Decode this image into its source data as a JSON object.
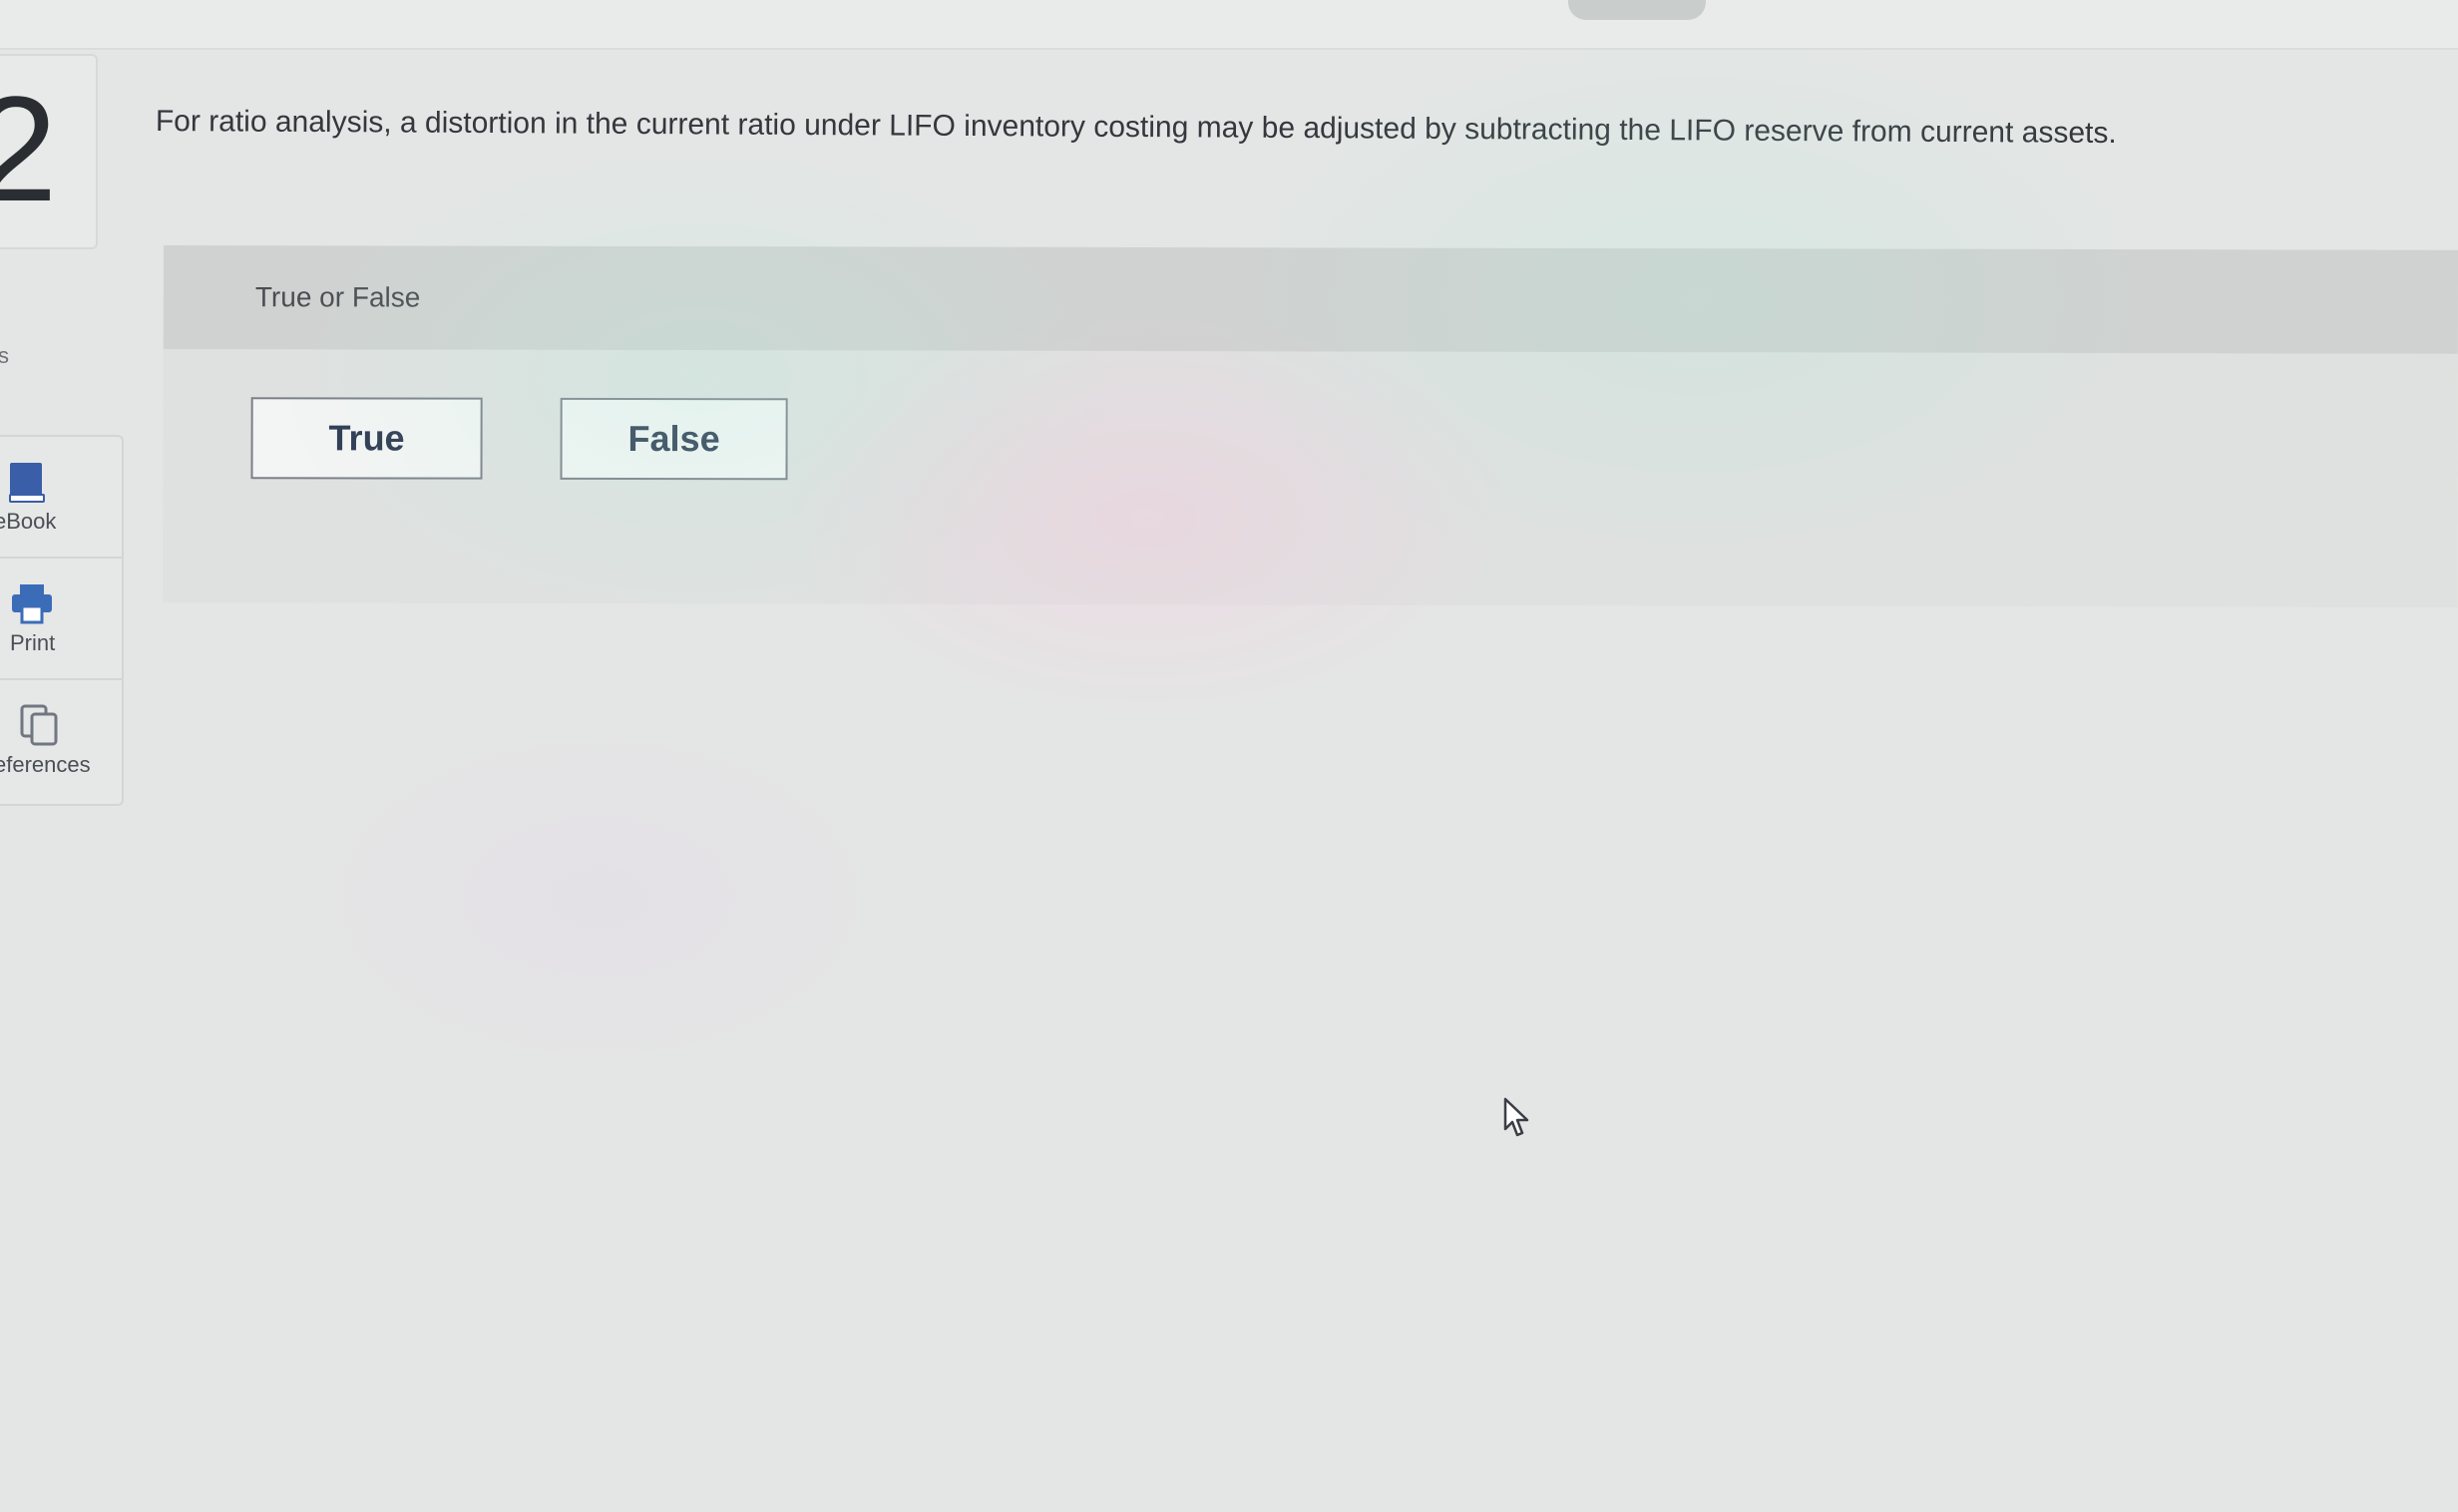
{
  "question": {
    "number": "2",
    "text": "For ratio analysis, a distortion in the current ratio under LIFO inventory costing may be adjusted by subtracting the LIFO reserve from current assets."
  },
  "sidebar": {
    "partial_label": "s",
    "tools": [
      {
        "label": "eBook",
        "icon": "ebook-icon"
      },
      {
        "label": "Print",
        "icon": "print-icon"
      },
      {
        "label": "eferences",
        "icon": "references-icon"
      }
    ]
  },
  "answer": {
    "type_label": "True or False",
    "options": [
      {
        "label": "True"
      },
      {
        "label": "False"
      }
    ]
  },
  "colors": {
    "button_text": "#2e3a52",
    "ebook_icon": "#3a5ea8",
    "print_icon": "#3b6cb8",
    "panel_bg": "#dadcdb"
  }
}
